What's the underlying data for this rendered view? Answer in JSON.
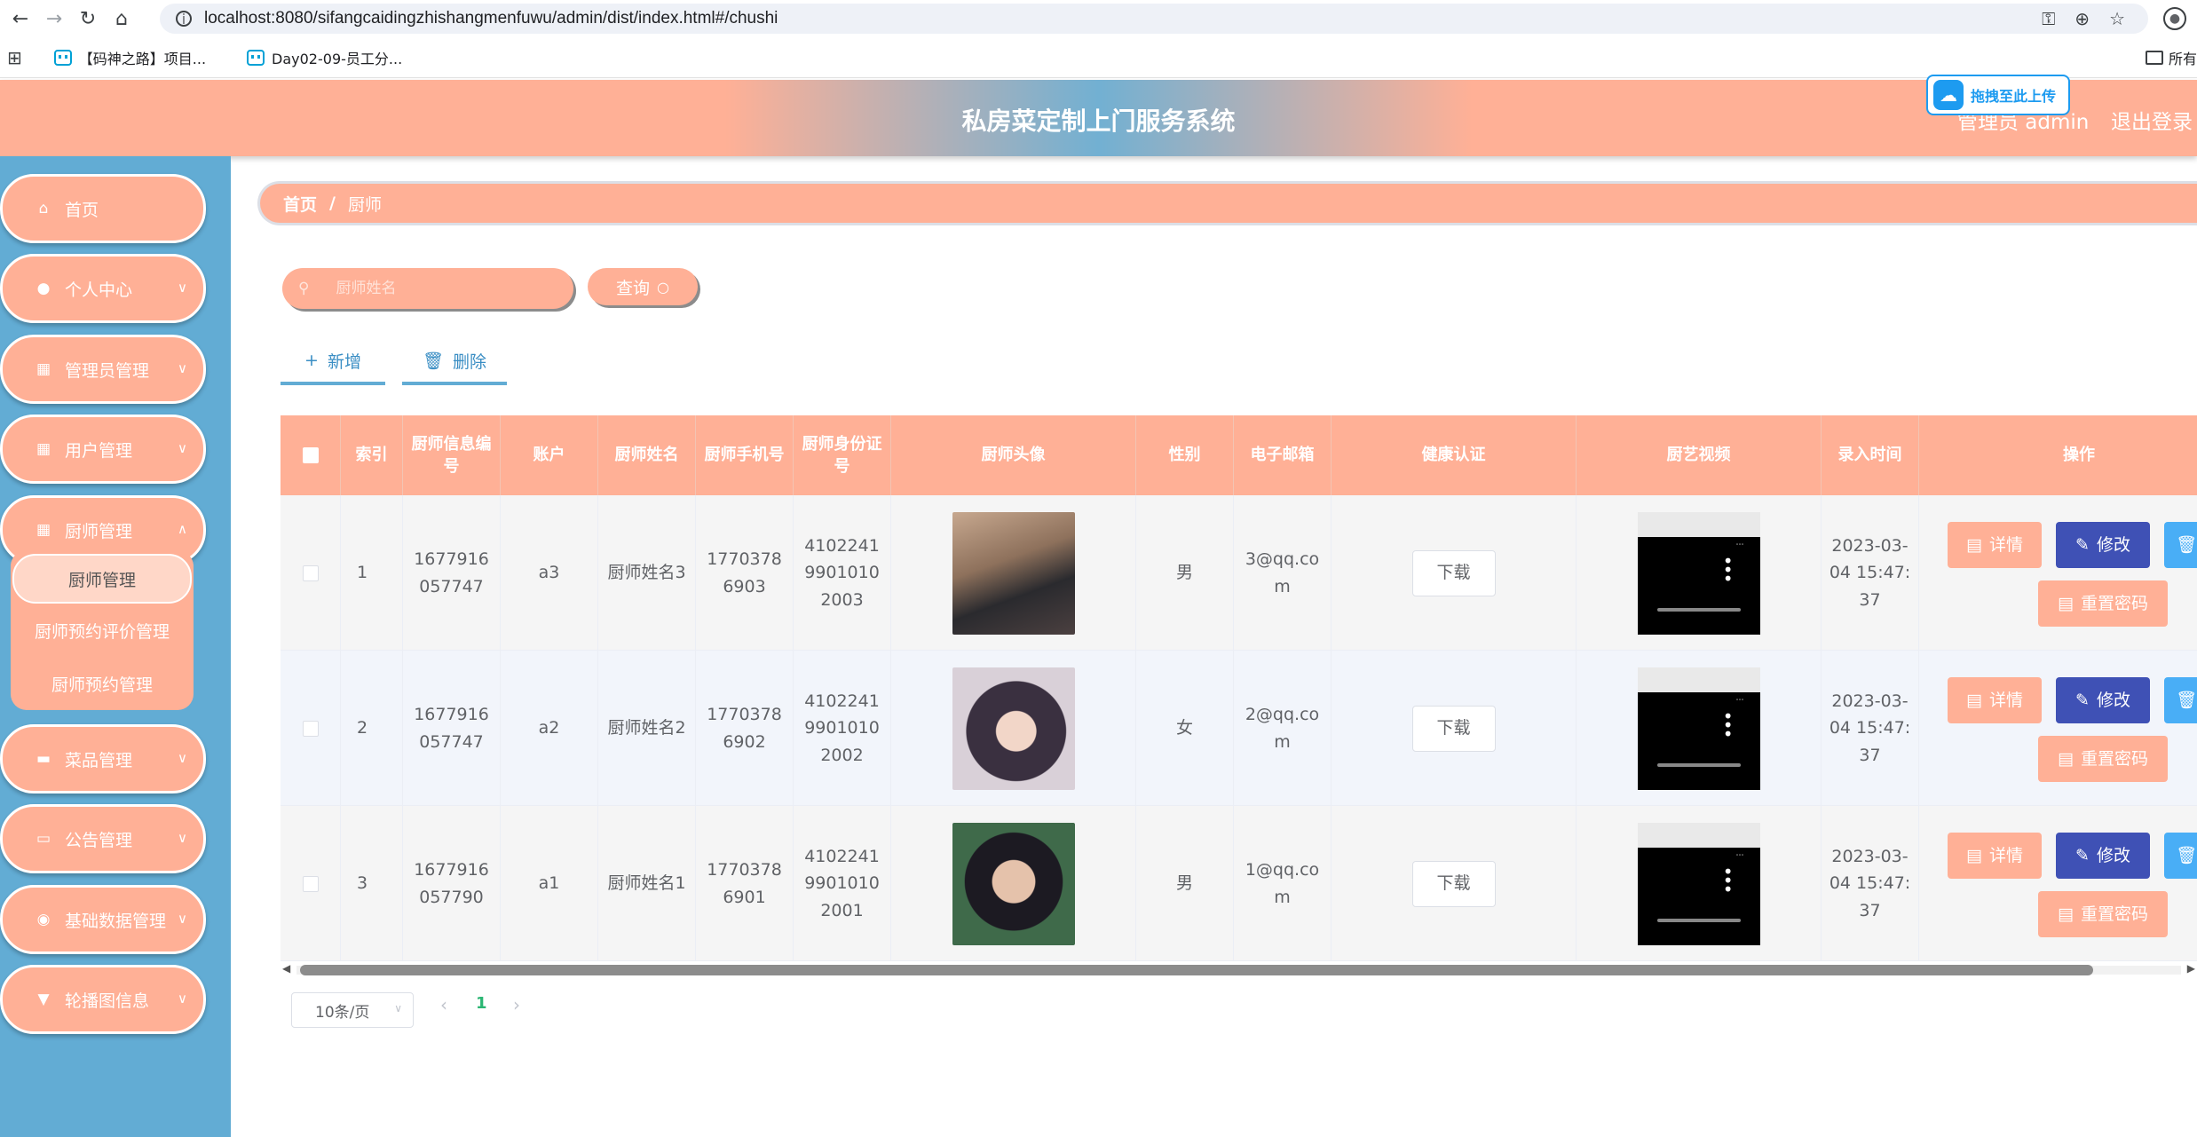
{
  "browser": {
    "url": "localhost:8080/sifangcaidingzhishangmenfuwu/admin/dist/index.html#/chushi",
    "bookmarks": [
      "【码神之路】项目...",
      "Day02-09-员工分..."
    ],
    "bookmarks_right": "所有"
  },
  "header": {
    "title": "私房菜定制上门服务系统",
    "user": "管理员 admin",
    "logout": "退出登录",
    "upload_widget": "拖拽至此上传"
  },
  "sidebar": {
    "items": [
      {
        "label": "首页",
        "icon": "home-icon"
      },
      {
        "label": "个人中心",
        "icon": "user-icon"
      },
      {
        "label": "管理员管理",
        "icon": "grid-icon"
      },
      {
        "label": "用户管理",
        "icon": "grid-icon"
      },
      {
        "label": "厨师管理",
        "icon": "grid-icon"
      },
      {
        "label": "菜品管理",
        "icon": "card-icon"
      },
      {
        "label": "公告管理",
        "icon": "monitor-icon"
      },
      {
        "label": "基础数据管理",
        "icon": "pin-icon"
      },
      {
        "label": "轮播图信息",
        "icon": "stamp-icon"
      }
    ],
    "submenu": [
      "厨师管理",
      "厨师预约评价管理",
      "厨师预约管理"
    ]
  },
  "breadcrumb": {
    "home": "首页",
    "sep": "/",
    "current": "厨师"
  },
  "search": {
    "placeholder": "厨师姓名",
    "button": "查询"
  },
  "actions": {
    "add": "新增",
    "delete": "删除"
  },
  "table": {
    "headers": [
      "索引",
      "厨师信息编号",
      "账户",
      "厨师姓名",
      "厨师手机号",
      "厨师身份证号",
      "厨师头像",
      "性别",
      "电子邮箱",
      "健康认证",
      "厨艺视频",
      "录入时间",
      "操作"
    ],
    "download_label": "下载",
    "ops": {
      "detail": "详情",
      "edit": "修改",
      "reset": "重置密码"
    },
    "rows": [
      {
        "index": "1",
        "code": "1677916057747",
        "account": "a3",
        "name": "厨师姓名3",
        "phone": "17703786903",
        "idcard": "410224199010102003",
        "gender": "男",
        "email": "3@qq.com",
        "time": "2023-03-04 15:47:37"
      },
      {
        "index": "2",
        "code": "1677916057747",
        "account": "a2",
        "name": "厨师姓名2",
        "phone": "17703786902",
        "idcard": "410224199010102002",
        "gender": "女",
        "email": "2@qq.com",
        "time": "2023-03-04 15:47:37"
      },
      {
        "index": "3",
        "code": "1677916057790",
        "account": "a1",
        "name": "厨师姓名1",
        "phone": "17703786901",
        "idcard": "410224199010102001",
        "gender": "男",
        "email": "1@qq.com",
        "time": "2023-03-04 15:47:37"
      }
    ]
  },
  "pagination": {
    "page_size": "10条/页",
    "current_page": "1"
  }
}
